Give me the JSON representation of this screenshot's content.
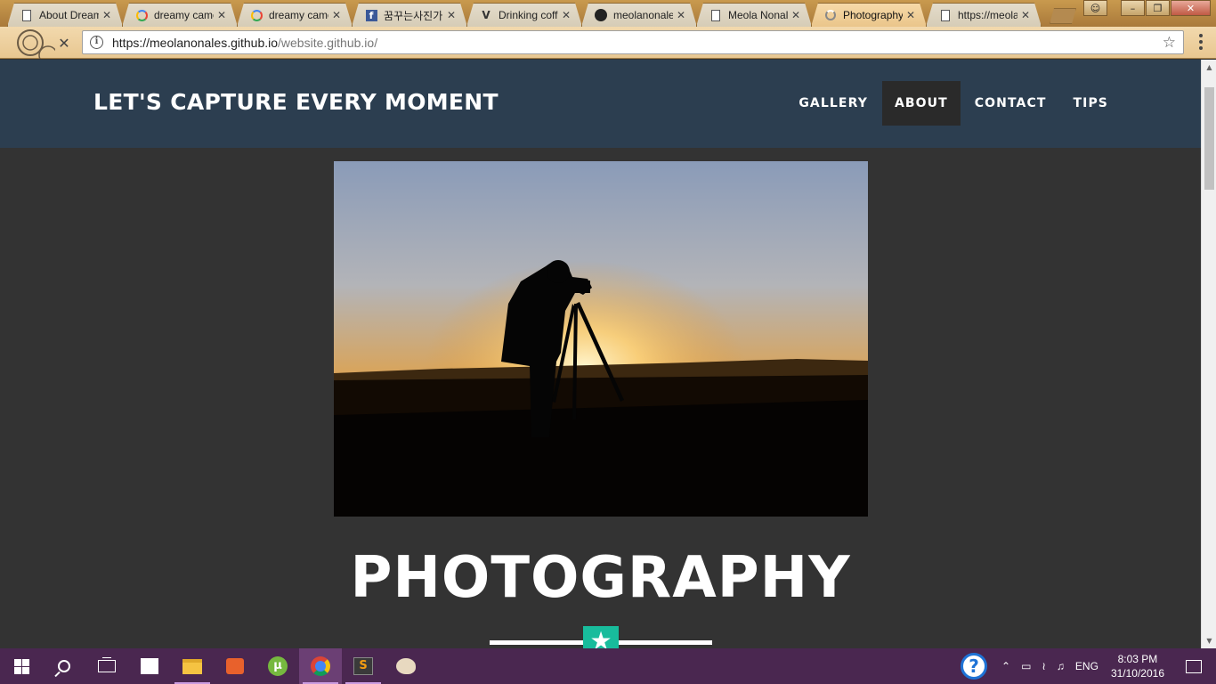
{
  "browser": {
    "tabs": [
      {
        "title": "About Dream",
        "favicon": "page-icon",
        "active": false
      },
      {
        "title": "dreamy came",
        "favicon": "google-icon",
        "active": false
      },
      {
        "title": "dreamy came",
        "favicon": "google-icon",
        "active": false
      },
      {
        "title": "꿈꾸는사진가",
        "favicon": "facebook-icon",
        "active": false
      },
      {
        "title": "Drinking coffe",
        "favicon": "vimeo-icon",
        "active": false
      },
      {
        "title": "meolanonale",
        "favicon": "github-icon",
        "active": false
      },
      {
        "title": "Meola Nonal",
        "favicon": "page-icon",
        "active": false
      },
      {
        "title": "Photography",
        "favicon": "loading-icon",
        "active": true
      },
      {
        "title": "https://meola",
        "favicon": "page-icon",
        "active": false
      }
    ],
    "close_glyph": "✕",
    "address": {
      "host": "https://meolanonales.github.io",
      "path": "/website.github.io/"
    }
  },
  "site": {
    "brand": "LET'S CAPTURE EVERY MOMENT",
    "nav": [
      {
        "label": "GALLERY",
        "active": false
      },
      {
        "label": "ABOUT",
        "active": true
      },
      {
        "label": "CONTACT",
        "active": false
      },
      {
        "label": "TIPS",
        "active": false
      }
    ],
    "hero_image": "photographer-silhouette-sunset",
    "title": "PHOTOGRAPHY",
    "divider_icon": "star-icon",
    "colors": {
      "navbar": "#2c3e50",
      "background": "#333333",
      "accent": "#18bc9c"
    }
  },
  "taskbar": {
    "apps": [
      "start",
      "search",
      "task-view",
      "store",
      "file-explorer",
      "media-player",
      "utorrent",
      "chrome",
      "sublime-text",
      "paint"
    ],
    "language": "ENG",
    "time": "8:03 PM",
    "date": "31/10/2016"
  }
}
